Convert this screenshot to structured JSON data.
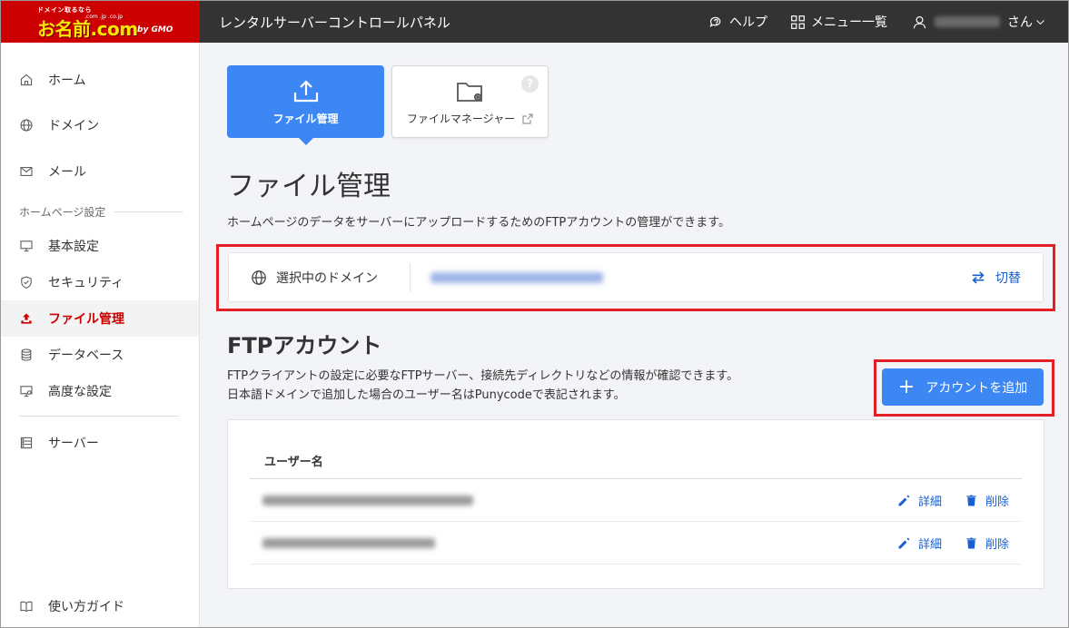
{
  "header": {
    "logo_tagline": "ドメイン取るなら",
    "logo_brand": "お名前.com",
    "logo_domains": ".com .jp .co.jp",
    "logo_gmo": "by GMO",
    "app_title": "レンタルサーバーコントロールパネル",
    "help_label": "ヘルプ",
    "menu_label": "メニュー一覧",
    "user_suffix": "さん"
  },
  "sidebar": {
    "items": [
      {
        "label": "ホーム",
        "icon": "home-icon"
      },
      {
        "label": "ドメイン",
        "icon": "globe-icon"
      },
      {
        "label": "メール",
        "icon": "mail-icon"
      }
    ],
    "section_label": "ホームページ設定",
    "hp_items": [
      {
        "label": "基本設定",
        "icon": "monitor-icon"
      },
      {
        "label": "セキュリティ",
        "icon": "shield-icon"
      },
      {
        "label": "ファイル管理",
        "icon": "upload-icon",
        "active": true
      },
      {
        "label": "データベース",
        "icon": "database-icon"
      },
      {
        "label": "高度な設定",
        "icon": "advanced-settings-icon"
      }
    ],
    "server_label": "サーバー",
    "guide_label": "使い方ガイド"
  },
  "tiles": {
    "active_label": "ファイル管理",
    "other_label": "ファイルマネージャー",
    "help_mark": "?"
  },
  "page": {
    "title": "ファイル管理",
    "description": "ホームページのデータをサーバーにアップロードするためのFTPアカウントの管理ができます。"
  },
  "domain_selector": {
    "label": "選択中のドメイン",
    "switch_label": "切替"
  },
  "ftp": {
    "title": "FTPアカウント",
    "desc_line1": "FTPクライアントの設定に必要なFTPサーバー、接続先ディレクトリなどの情報が確認できます。",
    "desc_line2": "日本語ドメインで追加した場合のユーザー名はPunycodeで表記されます。",
    "add_button_label": "アカウントを追加",
    "table_header_username": "ユーザー名",
    "rows": [
      {
        "detail_label": "詳細",
        "delete_label": "削除"
      },
      {
        "detail_label": "詳細",
        "delete_label": "削除"
      }
    ]
  },
  "colors": {
    "brand_red": "#cc0000",
    "primary_blue": "#3d87f5",
    "link_blue": "#1a5fd0",
    "highlight_red": "#e31e24"
  }
}
